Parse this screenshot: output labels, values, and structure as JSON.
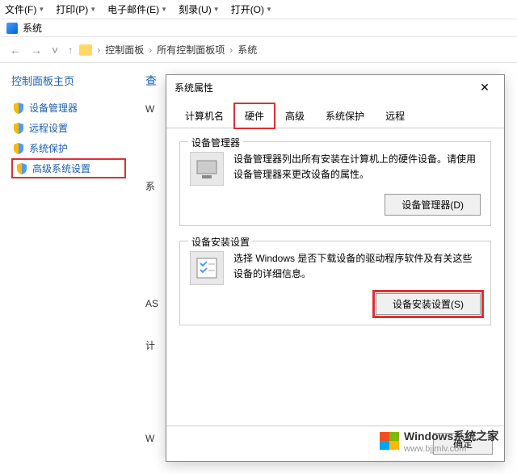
{
  "menubar": {
    "items": [
      "文件(F)",
      "打印(P)",
      "电子邮件(E)",
      "刻录(U)",
      "打开(O)"
    ]
  },
  "titlebar": {
    "title": "系统"
  },
  "addrbar": {
    "crumbs": [
      "控制面板",
      "所有控制面板项",
      "系统"
    ]
  },
  "sidebar": {
    "title": "控制面板主页",
    "items": [
      {
        "label": "设备管理器"
      },
      {
        "label": "远程设置"
      },
      {
        "label": "系统保护"
      },
      {
        "label": "高级系统设置"
      }
    ]
  },
  "main_peek": {
    "heading": "查",
    "lines": [
      "W",
      "系",
      "AS",
      "计",
      "W"
    ]
  },
  "dialog": {
    "title": "系统属性",
    "tabs": [
      "计算机名",
      "硬件",
      "高级",
      "系统保护",
      "远程"
    ],
    "active_tab": 1,
    "group1": {
      "title": "设备管理器",
      "text": "设备管理器列出所有安装在计算机上的硬件设备。请使用设备管理器来更改设备的属性。",
      "btn": "设备管理器(D)"
    },
    "group2": {
      "title": "设备安装设置",
      "text": "选择 Windows 是否下载设备的驱动程序软件及有关这些设备的详细信息。",
      "btn": "设备安装设置(S)"
    },
    "footer": {
      "ok": "确定"
    }
  },
  "watermark": {
    "text": "Windows系统之家",
    "url": "www.bjjmlv.com"
  }
}
